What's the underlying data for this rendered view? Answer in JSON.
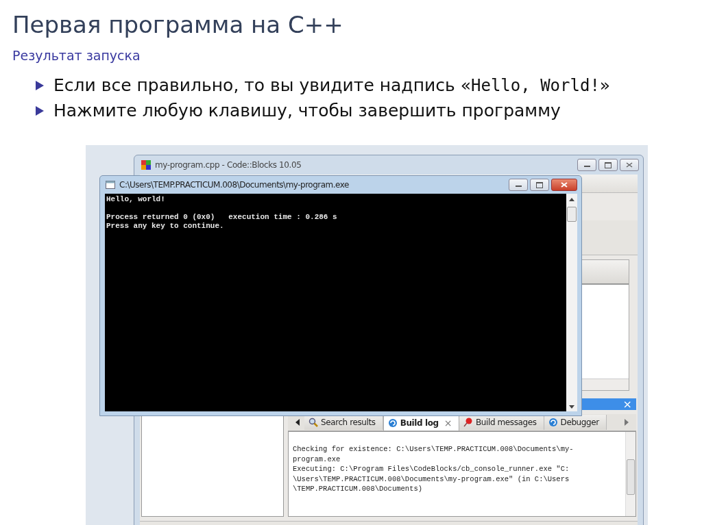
{
  "slide": {
    "title": "Первая программа на C++",
    "subtitle": "Результат запуска",
    "bullets": [
      {
        "parts": [
          {
            "kind": "text",
            "text": "Если все правильно, то вы увидите надпись «"
          },
          {
            "kind": "code",
            "text": "Hello, World!"
          },
          {
            "kind": "text",
            "text": "»"
          }
        ]
      },
      {
        "parts": [
          {
            "kind": "text",
            "text": "Нажмите любую клавишу, чтобы завершить программу"
          }
        ]
      }
    ]
  },
  "ide_window": {
    "title": "my-program.cpp - Code::Blocks 10.05",
    "tabs": [
      {
        "label": "Search results",
        "selected": false,
        "closable": false,
        "kind": "search"
      },
      {
        "label": "Build log",
        "selected": true,
        "closable": true,
        "kind": "log"
      },
      {
        "label": "Build messages",
        "selected": false,
        "closable": false,
        "kind": "pin"
      },
      {
        "label": "Debugger",
        "selected": false,
        "closable": false,
        "kind": "log"
      }
    ],
    "close_glyph": "×",
    "log_lines": [
      "Checking for existence: C:\\Users\\TEMP.PRACTICUM.008\\Documents\\my-",
      "program.exe",
      "Executing: C:\\Program Files\\CodeBlocks/cb_console_runner.exe \"C:",
      "\\Users\\TEMP.PRACTICUM.008\\Documents\\my-program.exe\" (in C:\\Users",
      "\\TEMP.PRACTICUM.008\\Documents)"
    ]
  },
  "console_window": {
    "title": "C:\\Users\\TEMP.PRACTICUM.008\\Documents\\my-program.exe",
    "line_groups": [
      [
        "Hello, world!"
      ],
      [
        "Process returned 0 (0x0)   execution time : 0.286 s",
        "Press any key to continue."
      ]
    ]
  }
}
